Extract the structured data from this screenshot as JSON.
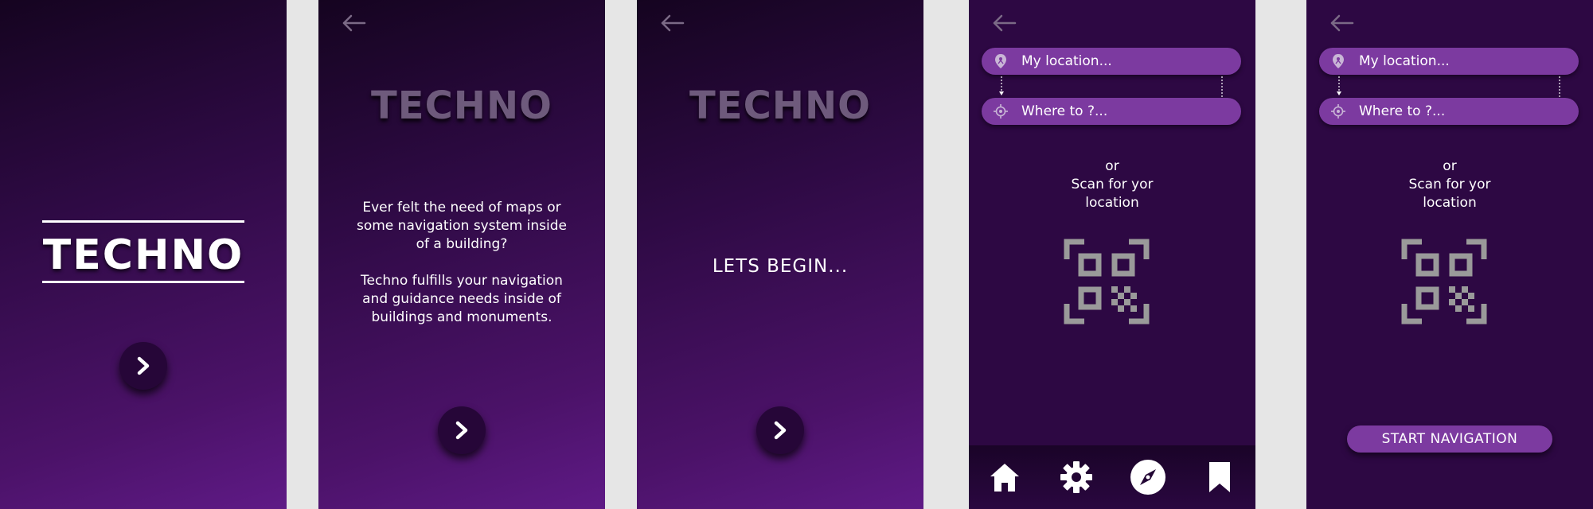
{
  "app": {
    "name": "TECHNO"
  },
  "splash": {
    "title": "TECHNO"
  },
  "intro": {
    "title": "TECHNO",
    "lines": [
      "Ever felt the need of maps or",
      "some navigation system inside",
      "of a building?",
      "",
      "Techno fulfills your navigation",
      "and guidance needs inside of",
      "buildings and monuments."
    ]
  },
  "begin": {
    "title": "TECHNO",
    "message": "LETS BEGIN..."
  },
  "search": {
    "my_location_placeholder": "My location...",
    "destination_placeholder": "Where to ?...",
    "or_label": "or",
    "scan_line1": "Scan for yor",
    "scan_line2": "location",
    "nav_items": [
      "home-icon",
      "gear-icon",
      "compass-icon",
      "bookmark-icon"
    ]
  },
  "start": {
    "my_location_placeholder": "My location...",
    "destination_placeholder": "Where to ?...",
    "or_label": "or",
    "scan_line1": "Scan for yor",
    "scan_line2": "location",
    "start_button": "START NAVIGATION"
  },
  "colors": {
    "background": "#e6e6e6",
    "gradient_dark": "#150420",
    "gradient_light": "#5f1a86",
    "pill": "#7c3aa0",
    "qr": "#999999",
    "title_muted": "#6e5a7c"
  }
}
